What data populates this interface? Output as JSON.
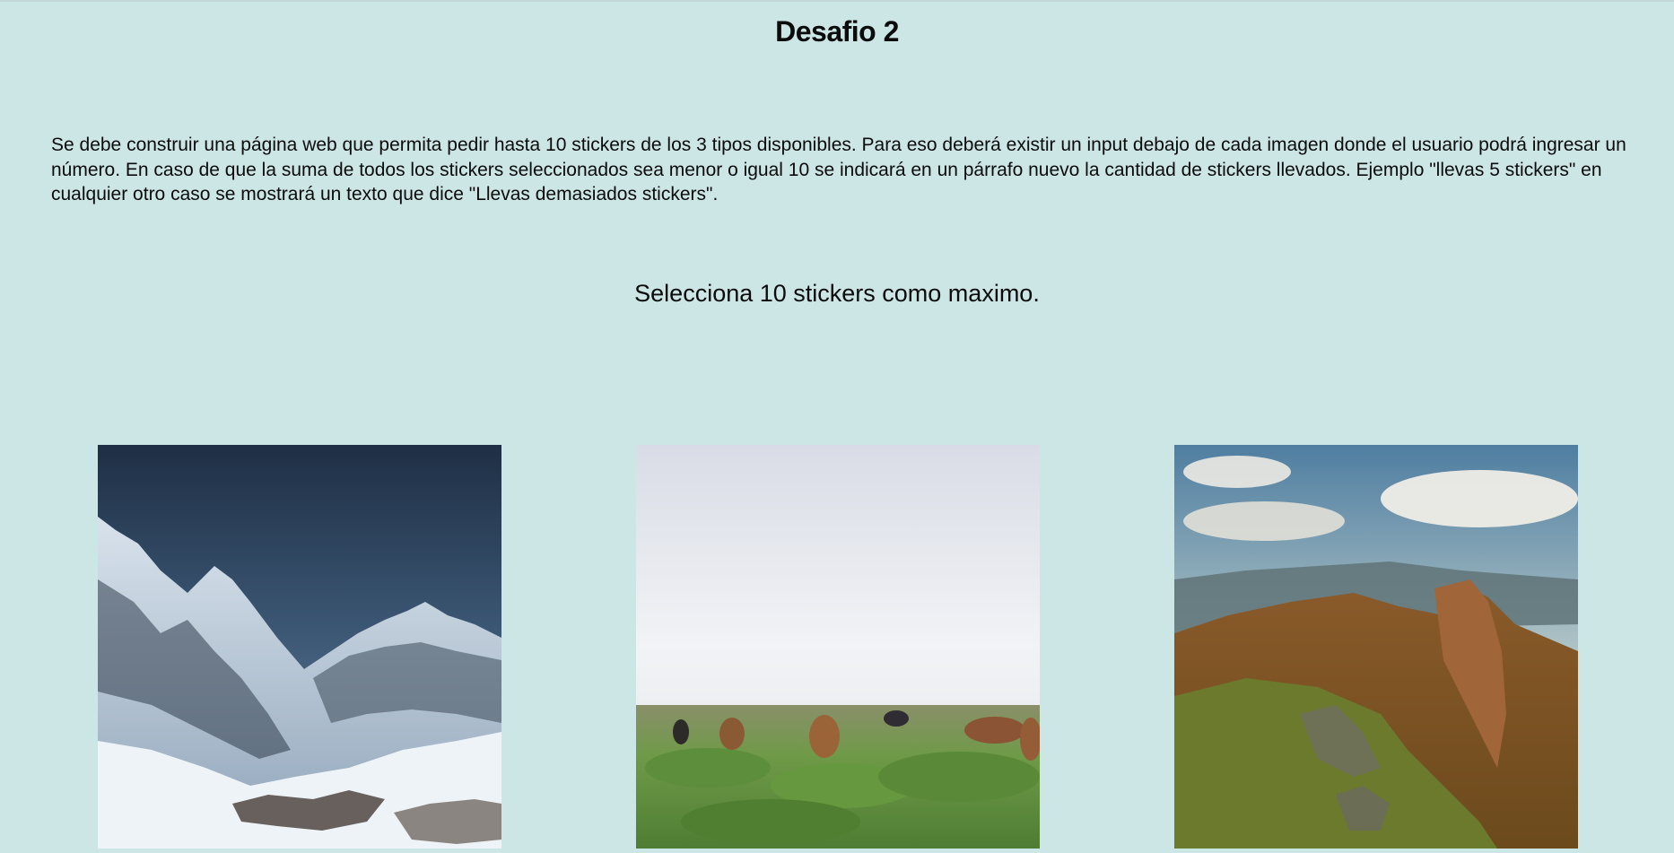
{
  "page": {
    "title": "Desafio 2",
    "description": "Se debe construir una página web que permita pedir hasta 10 stickers de los 3 tipos disponibles. Para eso deberá existir un input debajo de cada imagen donde el usuario podrá ingresar un número. En caso de que la suma de todos los stickers seleccionados sea menor o igual 10 se indicará en un párrafo nuevo la cantidad de stickers llevados. Ejemplo \"llevas 5 stickers\" en cualquier otro caso se mostrará un texto que dice \"Llevas demasiados stickers\".",
    "subtitle": "Selecciona 10 stickers como maximo."
  },
  "stickers": [
    {
      "image": "snowy-mountains-photo"
    },
    {
      "image": "horses-on-grassland-photo"
    },
    {
      "image": "autumn-mountain-ridge-photo"
    }
  ],
  "colors": {
    "background": "#cce5e5",
    "text": "#0c0c0c"
  }
}
